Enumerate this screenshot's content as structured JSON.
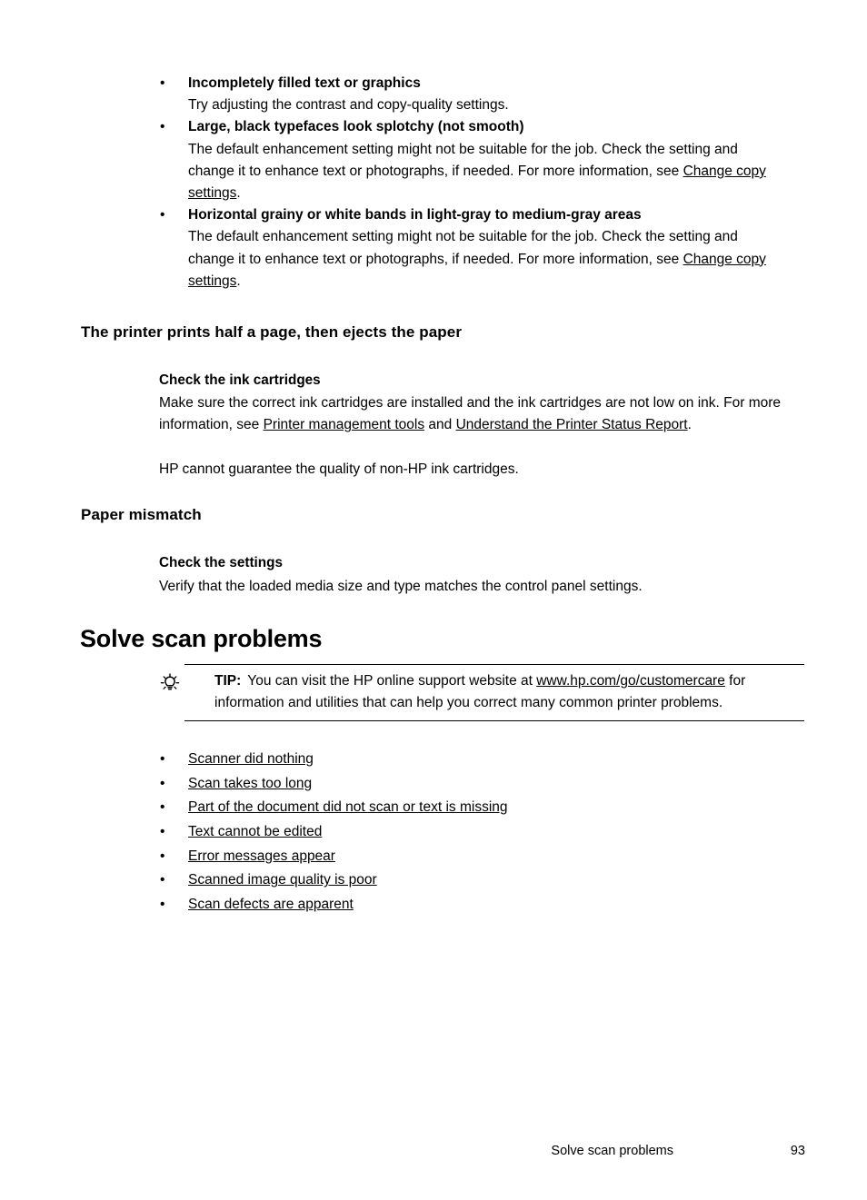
{
  "problem_list": [
    {
      "bullet": "•",
      "title": "Incompletely filled text or graphics",
      "body_lines": [
        "Try adjusting the contrast and copy-quality settings."
      ],
      "body_plain": "Try adjusting the contrast and copy-quality settings.",
      "body_prefix": "",
      "body_link": "",
      "body_suffix": ""
    },
    {
      "bullet": "•",
      "title": "Large, black typefaces look splotchy (not smooth)",
      "body_prefix": "The default enhancement setting might not be suitable for the job. Check the setting and change it to enhance text or photographs, if needed. For more information, see ",
      "body_link": "Change copy settings",
      "body_suffix": "."
    },
    {
      "bullet": "•",
      "title": "Horizontal grainy or white bands in light-gray to medium-gray areas",
      "body_prefix": "The default enhancement setting might not be suitable for the job. Check the setting and change it to enhance text or photographs, if needed. For more information, see ",
      "body_link": "Change copy settings",
      "body_suffix": "."
    }
  ],
  "section_half_page": {
    "heading": "The printer prints half a page, then ejects the paper",
    "sub_heading": "Check the ink cartridges",
    "para_prefix": "Make sure the correct ink cartridges are installed and the ink cartridges are not low on ink. For more information, see ",
    "link_one": "Printer management tools",
    "para_mid": " and ",
    "link_two": "Understand the Printer Status Report",
    "para_suffix": ".",
    "para_second": "HP cannot guarantee the quality of non-HP ink cartridges."
  },
  "section_paper_mismatch": {
    "heading": "Paper mismatch",
    "sub_heading": "Check the settings",
    "para": "Verify that the loaded media size and type matches the control panel settings."
  },
  "solve_scan": {
    "title": "Solve scan problems",
    "tip": {
      "icon": "lightbulb-icon",
      "label": "TIP:",
      "text_prefix": "You can visit the HP online support website at ",
      "link": "www.hp.com/go/customercare",
      "text_suffix": " for information and utilities that can help you correct many common printer problems."
    },
    "links": [
      {
        "bullet": "•",
        "label": "Scanner did nothing"
      },
      {
        "bullet": "•",
        "label": "Scan takes too long"
      },
      {
        "bullet": "•",
        "label": "Part of the document did not scan or text is missing"
      },
      {
        "bullet": "•",
        "label": "Text cannot be edited"
      },
      {
        "bullet": "•",
        "label": "Error messages appear"
      },
      {
        "bullet": "•",
        "label": "Scanned image quality is poor"
      },
      {
        "bullet": "•",
        "label": "Scan defects are apparent"
      }
    ]
  },
  "footer": {
    "title": "Solve scan problems",
    "page_number": "93"
  }
}
